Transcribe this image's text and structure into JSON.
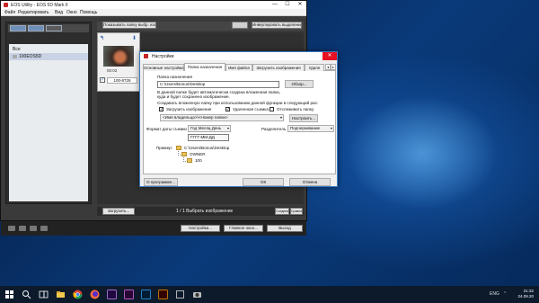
{
  "colors": {
    "dialog_border": "#3a79c0",
    "close_red": "#e81123",
    "desktop_blue": "#0a3a7a"
  },
  "eos": {
    "title": "EOS Utility - EOS 5D Mark II",
    "window_controls": [
      "—",
      "☐",
      "✕"
    ],
    "menu": [
      "Файл",
      "Редактировать",
      "Вид",
      "Окно",
      "Помощь"
    ],
    "folders": [
      "Все",
      "100EOS5D"
    ],
    "top_buttons": {
      "show_folder": "Показывать папку выбр. изобр.",
      "invert_selection": "Инвертировать выделение"
    },
    "thumb": {
      "time": "00:02",
      "filename": "100-8726",
      "checkmark": "✓",
      "rotate": "↰",
      "download": "⬇"
    },
    "download_button": "Загрузить...",
    "selection_count": "1 / 1 Выбрать изображение",
    "bottom_right_buttons": [
      "Соединить",
      "Сравнить"
    ],
    "footer_buttons": {
      "settings": "Настройки...",
      "main_window": "Главное окно...",
      "exit": "Выход"
    }
  },
  "settings": {
    "title": "Настройки",
    "close": "✕",
    "tabs": [
      "Основные настройки",
      "Папка назначения",
      "Имя файла",
      "Загрузить изображения",
      "Удале"
    ],
    "tab_arrows": [
      "◂",
      "▸"
    ],
    "destination_label": "Папка назначения",
    "destination_path": "C:\\Users\\Bonus\\Desktop",
    "browse_button": "Обзор...",
    "desc_line1": "В данной папке будет автоматически создана вложенная папка,",
    "desc_line2": "куда и будет сохранено изображение.",
    "create_subfolder_label": "Создавать вложенную папку при использовании данной функции в следующий раз:",
    "check_download": "Загрузить изображение",
    "check_remote": "Удаленная съемка",
    "check_monitor": "Отслеживать папку",
    "checkmark": "✓",
    "subfolder_pattern": "<Имя владельца>\\<Номер папки>",
    "configure_button": "Настроить...",
    "date_format_label": "Формат даты съемки",
    "date_format_value": "Год Месяц День",
    "separator_label": "Разделитель",
    "separator_value": "Подчеркивание",
    "date_sample": "ГГГГ-ММ-ДД",
    "example_label": "Пример:",
    "example_tree": [
      "C:\\Users\\Bonus\\Desktop",
      "OWNER",
      "100"
    ],
    "about_button": "О программе...",
    "ok_button": "ОК",
    "cancel_button": "Отмена",
    "dropdown_arrow": "▾"
  },
  "taskbar": {
    "icons": [
      "windows-start-icon",
      "search-icon",
      "task-view-icon",
      "file-explorer-icon",
      "chrome-icon",
      "firefox-icon",
      "after-effects-icon",
      "premiere-icon",
      "photoshop-icon",
      "illustrator-icon",
      "app-icon",
      "eos-utility-icon"
    ],
    "tray_glyphs": [
      "ENG",
      "⌃"
    ],
    "time": "21:32",
    "date": "24.09.20"
  }
}
